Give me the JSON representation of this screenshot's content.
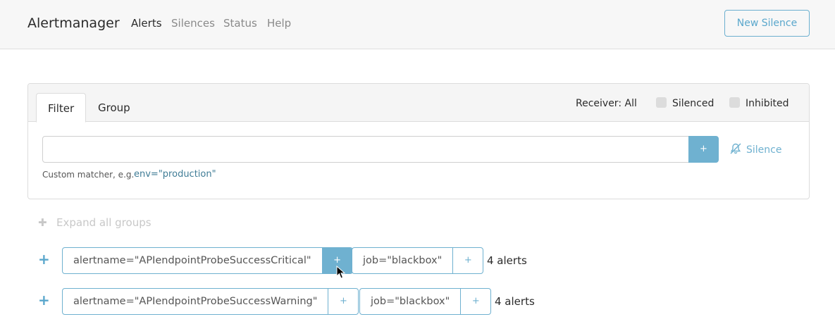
{
  "navbar": {
    "brand": "Alertmanager",
    "links": [
      "Alerts",
      "Silences",
      "Status",
      "Help"
    ],
    "active_link": "Alerts",
    "new_silence_label": "New Silence"
  },
  "filter_panel": {
    "tabs": [
      "Filter",
      "Group"
    ],
    "active_tab": "Filter",
    "receiver_label": "Receiver: All",
    "silenced_label": "Silenced",
    "inhibited_label": "Inhibited",
    "matcher_input_value": "",
    "add_button_label": "+",
    "silence_link_label": "Silence",
    "hint_text": "Custom matcher, e.g.",
    "hint_example": "env=\"production\""
  },
  "expand_all_label": "Expand all groups",
  "groups": [
    {
      "matchers": [
        "alertname=\"APIendpointProbeSuccessCritical\"",
        "job=\"blackbox\""
      ],
      "count_label": "4 alerts"
    },
    {
      "matchers": [
        "alertname=\"APIendpointProbeSuccessWarning\"",
        "job=\"blackbox\""
      ],
      "count_label": "4 alerts"
    }
  ],
  "colors": {
    "accent": "#6fb1d0",
    "navbar_bg": "#f7f7f7",
    "muted_text": "#8a8a8a"
  }
}
